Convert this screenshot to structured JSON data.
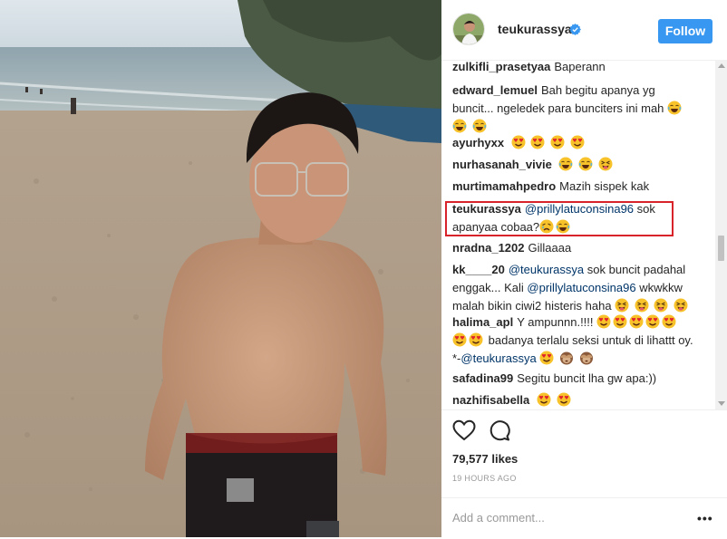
{
  "post": {
    "username": "teukurassya",
    "follow_label": "Follow",
    "verified": true,
    "photo_description_icon": "beach-selfie-photo"
  },
  "comments": [
    {
      "user": "zulkifli_prasetyaa",
      "text": "Baperann",
      "emojis": []
    },
    {
      "user": "edward_lemuel",
      "text": "Bah begitu apanya yg buncit... ngeledek para bunciters ini mah",
      "emojis": [
        "tears-of-joy",
        "tears-of-joy",
        "tears-of-joy"
      ]
    },
    {
      "user": "ayurhyxx",
      "text": "",
      "emojis": [
        "heart-eyes",
        "heart-eyes",
        "heart-eyes",
        "heart-eyes"
      ]
    },
    {
      "user": "nurhasanah_vivie",
      "text": "",
      "emojis": [
        "tears-of-joy",
        "tears-of-joy",
        "tongue-wink"
      ]
    },
    {
      "user": "murtimamahpedro",
      "text": "Mazih sispek kak",
      "emojis": []
    },
    {
      "user": "teukurassya",
      "mention": "@prillylatuconsina96",
      "text": "sok apanyaa cobaa?",
      "emojis": [
        "weary",
        "tears-of-joy"
      ]
    },
    {
      "user": "nradna_1202",
      "text": "Gillaaaa",
      "emojis": []
    },
    {
      "user": "kk____20",
      "mention": "@teukurassya",
      "text": "sok buncit padahal enggak... Kali",
      "mention2": "@prillylatuconsina96",
      "text2": "wkwkkw malah bikin ciwi2 histeris haha",
      "emojis": [
        "tongue-wink",
        "tongue-wink",
        "tongue-wink",
        "tongue-wink"
      ]
    },
    {
      "user": "halima_apl",
      "text": "Y ampunnn.!!!!",
      "text2": "badanya terlalu seksi untuk di lihattt oy. *-",
      "mention": "@teukurassya",
      "emojis_a": [
        "heart-eyes",
        "heart-eyes",
        "heart-eyes",
        "heart-eyes",
        "heart-eyes",
        "heart-eyes",
        "heart-eyes"
      ],
      "emojis_b": [
        "heart-eyes",
        "see-no-evil-monkey",
        "see-no-evil-monkey"
      ]
    },
    {
      "user": "safadina99",
      "text": "Segitu buncit lha gw apa:))",
      "emojis": []
    },
    {
      "user": "nazhifisabella",
      "text": "",
      "emojis": [
        "heart-eyes",
        "heart-eyes"
      ]
    }
  ],
  "actions": {
    "likes": "79,577 likes",
    "timestamp": "19 HOURS AGO",
    "add_comment_placeholder": "Add a comment...",
    "more_label": "•••"
  },
  "colors": {
    "accent": "#3897f0",
    "mention": "#003569",
    "highlight": "#d9232a",
    "muted": "#999999"
  }
}
